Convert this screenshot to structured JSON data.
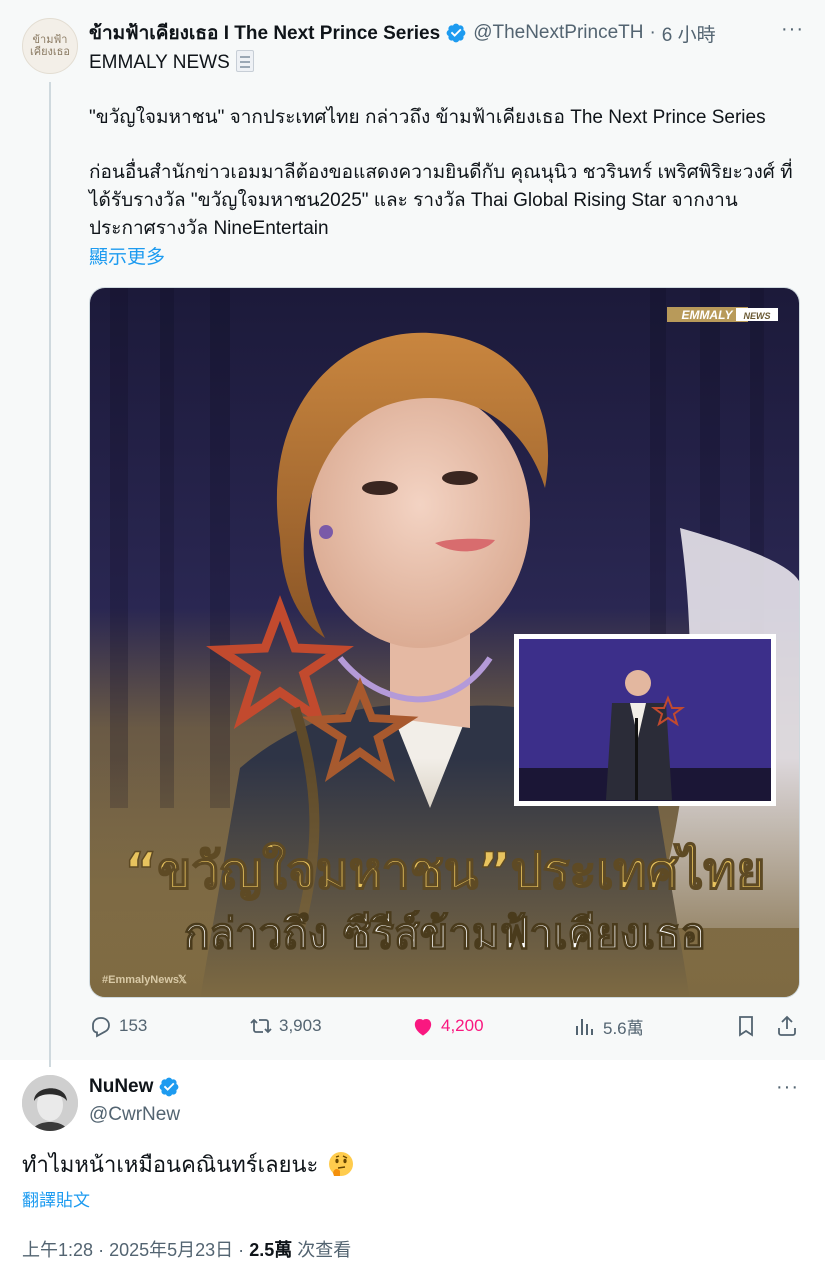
{
  "quoted_post": {
    "author_name": "ข้ามฟ้าเคียงเธอ I The Next Prince Series",
    "author_handle": "@TheNextPrinceTH",
    "separator": "·",
    "time": "6 小時",
    "more_label": "···",
    "avatar_text": "ข้ามฟ้า เคียงเธอ",
    "lines": [
      "EMMALY NEWS",
      "\"ขวัญใจมหาชน\" จากประเทศไทย กล่าวถึง ข้ามฟ้าเคียงเธอ The Next Prince Series",
      "ก่อนอื่นสำนักข่าวเอมมาลีต้องขอแสดงความยินดีกับ คุณนุนิว ชวรินทร์ เพริศพิริยะวงศ์ ที่",
      "ได้รับรางวัล \"ขวัญใจมหาชน2025\" และ รางวัล Thai Global Rising Star จากงาน",
      "ประกาศรางวัล NineEntertain"
    ],
    "show_more": "顯示更多",
    "image": {
      "logo_main": "EMMALY",
      "logo_sub": "NEWS",
      "headline_1": "“ขวัญใจมหาชน”ประเทศไทย",
      "headline_2": "กล่าวถึง ซีรีส์ข้ามฟ้าเคียงเธอ",
      "hashtag": "#EmmalyNews"
    },
    "stats": {
      "replies": "153",
      "reposts": "3,903",
      "likes": "4,200",
      "views": "5.6萬"
    }
  },
  "reply_post": {
    "author_name": "NuNew",
    "author_handle": "@CwrNew",
    "more_label": "···",
    "text": "ทำไมหน้าเหมือนคณินทร์เลยนะ",
    "translate": "翻譯貼文",
    "time": "上午1:28",
    "separator": "·",
    "date": "2025年5月23日",
    "views_count": "2.5萬",
    "views_label": "次查看"
  },
  "colors": {
    "accent": "#1d9bf0",
    "like": "#f91880",
    "muted": "#536471",
    "quoted_bg": "#f7f9f9"
  },
  "icons": [
    "verified-badge-icon",
    "document-icon",
    "reply-icon",
    "repost-icon",
    "heart-icon",
    "views-icon",
    "bookmark-icon",
    "share-icon",
    "thinking-face-icon"
  ]
}
